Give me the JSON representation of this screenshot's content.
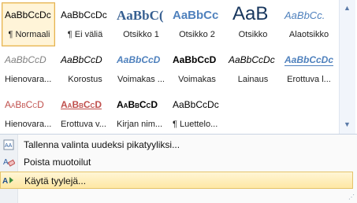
{
  "styles": [
    {
      "preview": "AaBbCcDc",
      "label": "¶ Normaali",
      "selected": true
    },
    {
      "preview": "AaBbCcDc",
      "label": "¶ Ei väliä",
      "selected": false
    },
    {
      "preview": "AaBbC(",
      "label": "Otsikko 1",
      "selected": false
    },
    {
      "preview": "AaBbCc",
      "label": "Otsikko 2",
      "selected": false
    },
    {
      "preview": "AaB",
      "label": "Otsikko",
      "selected": false
    },
    {
      "preview": "AaBbCc.",
      "label": "Alaotsikko",
      "selected": false
    },
    {
      "preview": "AaBbCcD",
      "label": "Hienovara...",
      "selected": false
    },
    {
      "preview": "AaBbCcD",
      "label": "Korostus",
      "selected": false
    },
    {
      "preview": "AaBbCcD",
      "label": "Voimakas ...",
      "selected": false
    },
    {
      "preview": "AaBbCcD",
      "label": "Voimakas",
      "selected": false
    },
    {
      "preview": "AaBbCcDc",
      "label": "Lainaus",
      "selected": false
    },
    {
      "preview": "AaBbCcDc",
      "label": "Erottuva l...",
      "selected": false
    },
    {
      "preview": "AaBbCcD",
      "label": "Hienovara...",
      "selected": false
    },
    {
      "preview": "AaBbCcD",
      "label": "Erottuva v...",
      "selected": false
    },
    {
      "preview": "AaBbCcD",
      "label": "Kirjan nim...",
      "selected": false
    },
    {
      "preview": "AaBbCcDc",
      "label": "¶ Luettelo...",
      "selected": false
    }
  ],
  "menu": {
    "save_selection": "Tallenna valinta uudeksi pikatyyliksi...",
    "clear_formatting": "Poista muotoilut",
    "apply_styles": "Käytä tyylejä..."
  },
  "colors": {
    "highlight": "#fee7a3",
    "heading_blue": "#365f91"
  }
}
